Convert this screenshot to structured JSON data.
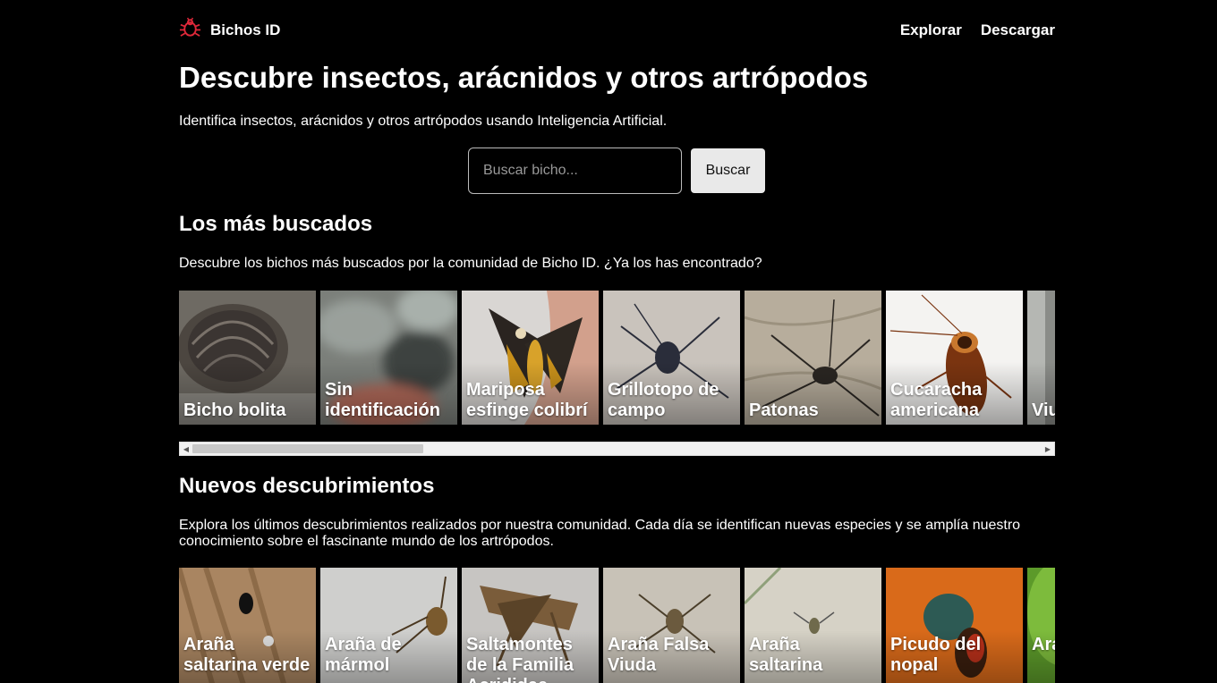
{
  "brand": {
    "name": "Bichos ID",
    "icon": "bug-logo-icon",
    "accent": "#e0283a"
  },
  "nav": {
    "links": [
      "Explorar",
      "Descargar"
    ]
  },
  "hero": {
    "title": "Descubre insectos, arácnidos y otros artrópodos",
    "subtitle": "Identifica insectos, arácnidos y otros artrópodos usando Inteligencia Artificial."
  },
  "search": {
    "placeholder": "Buscar bicho...",
    "value": "",
    "button": "Buscar"
  },
  "popular": {
    "title": "Los más buscados",
    "description": "Descubre los bichos más buscados por la comunidad de Bicho ID. ¿Ya los has encontrado?",
    "cards": [
      {
        "label": "Bicho bolita"
      },
      {
        "label": "Sin identificación"
      },
      {
        "label": "Mariposa esfinge colibrí"
      },
      {
        "label": "Grillotopo de campo"
      },
      {
        "label": "Patonas"
      },
      {
        "label": "Cucaracha americana"
      },
      {
        "label": "Viu"
      }
    ]
  },
  "recent": {
    "title": "Nuevos descubrimientos",
    "description": "Explora los últimos descubrimientos realizados por nuestra comunidad. Cada día se identifican nuevas especies y se amplía nuestro conocimiento sobre el fascinante mundo de los artrópodos.",
    "cards": [
      {
        "label": "Araña saltarina verde"
      },
      {
        "label": "Araña de mármol"
      },
      {
        "label": "Saltamontes de la Familia Acrididae"
      },
      {
        "label": "Araña Falsa Viuda"
      },
      {
        "label": "Araña saltarina"
      },
      {
        "label": "Picudo del nopal"
      },
      {
        "label": "Araña ca"
      }
    ]
  }
}
